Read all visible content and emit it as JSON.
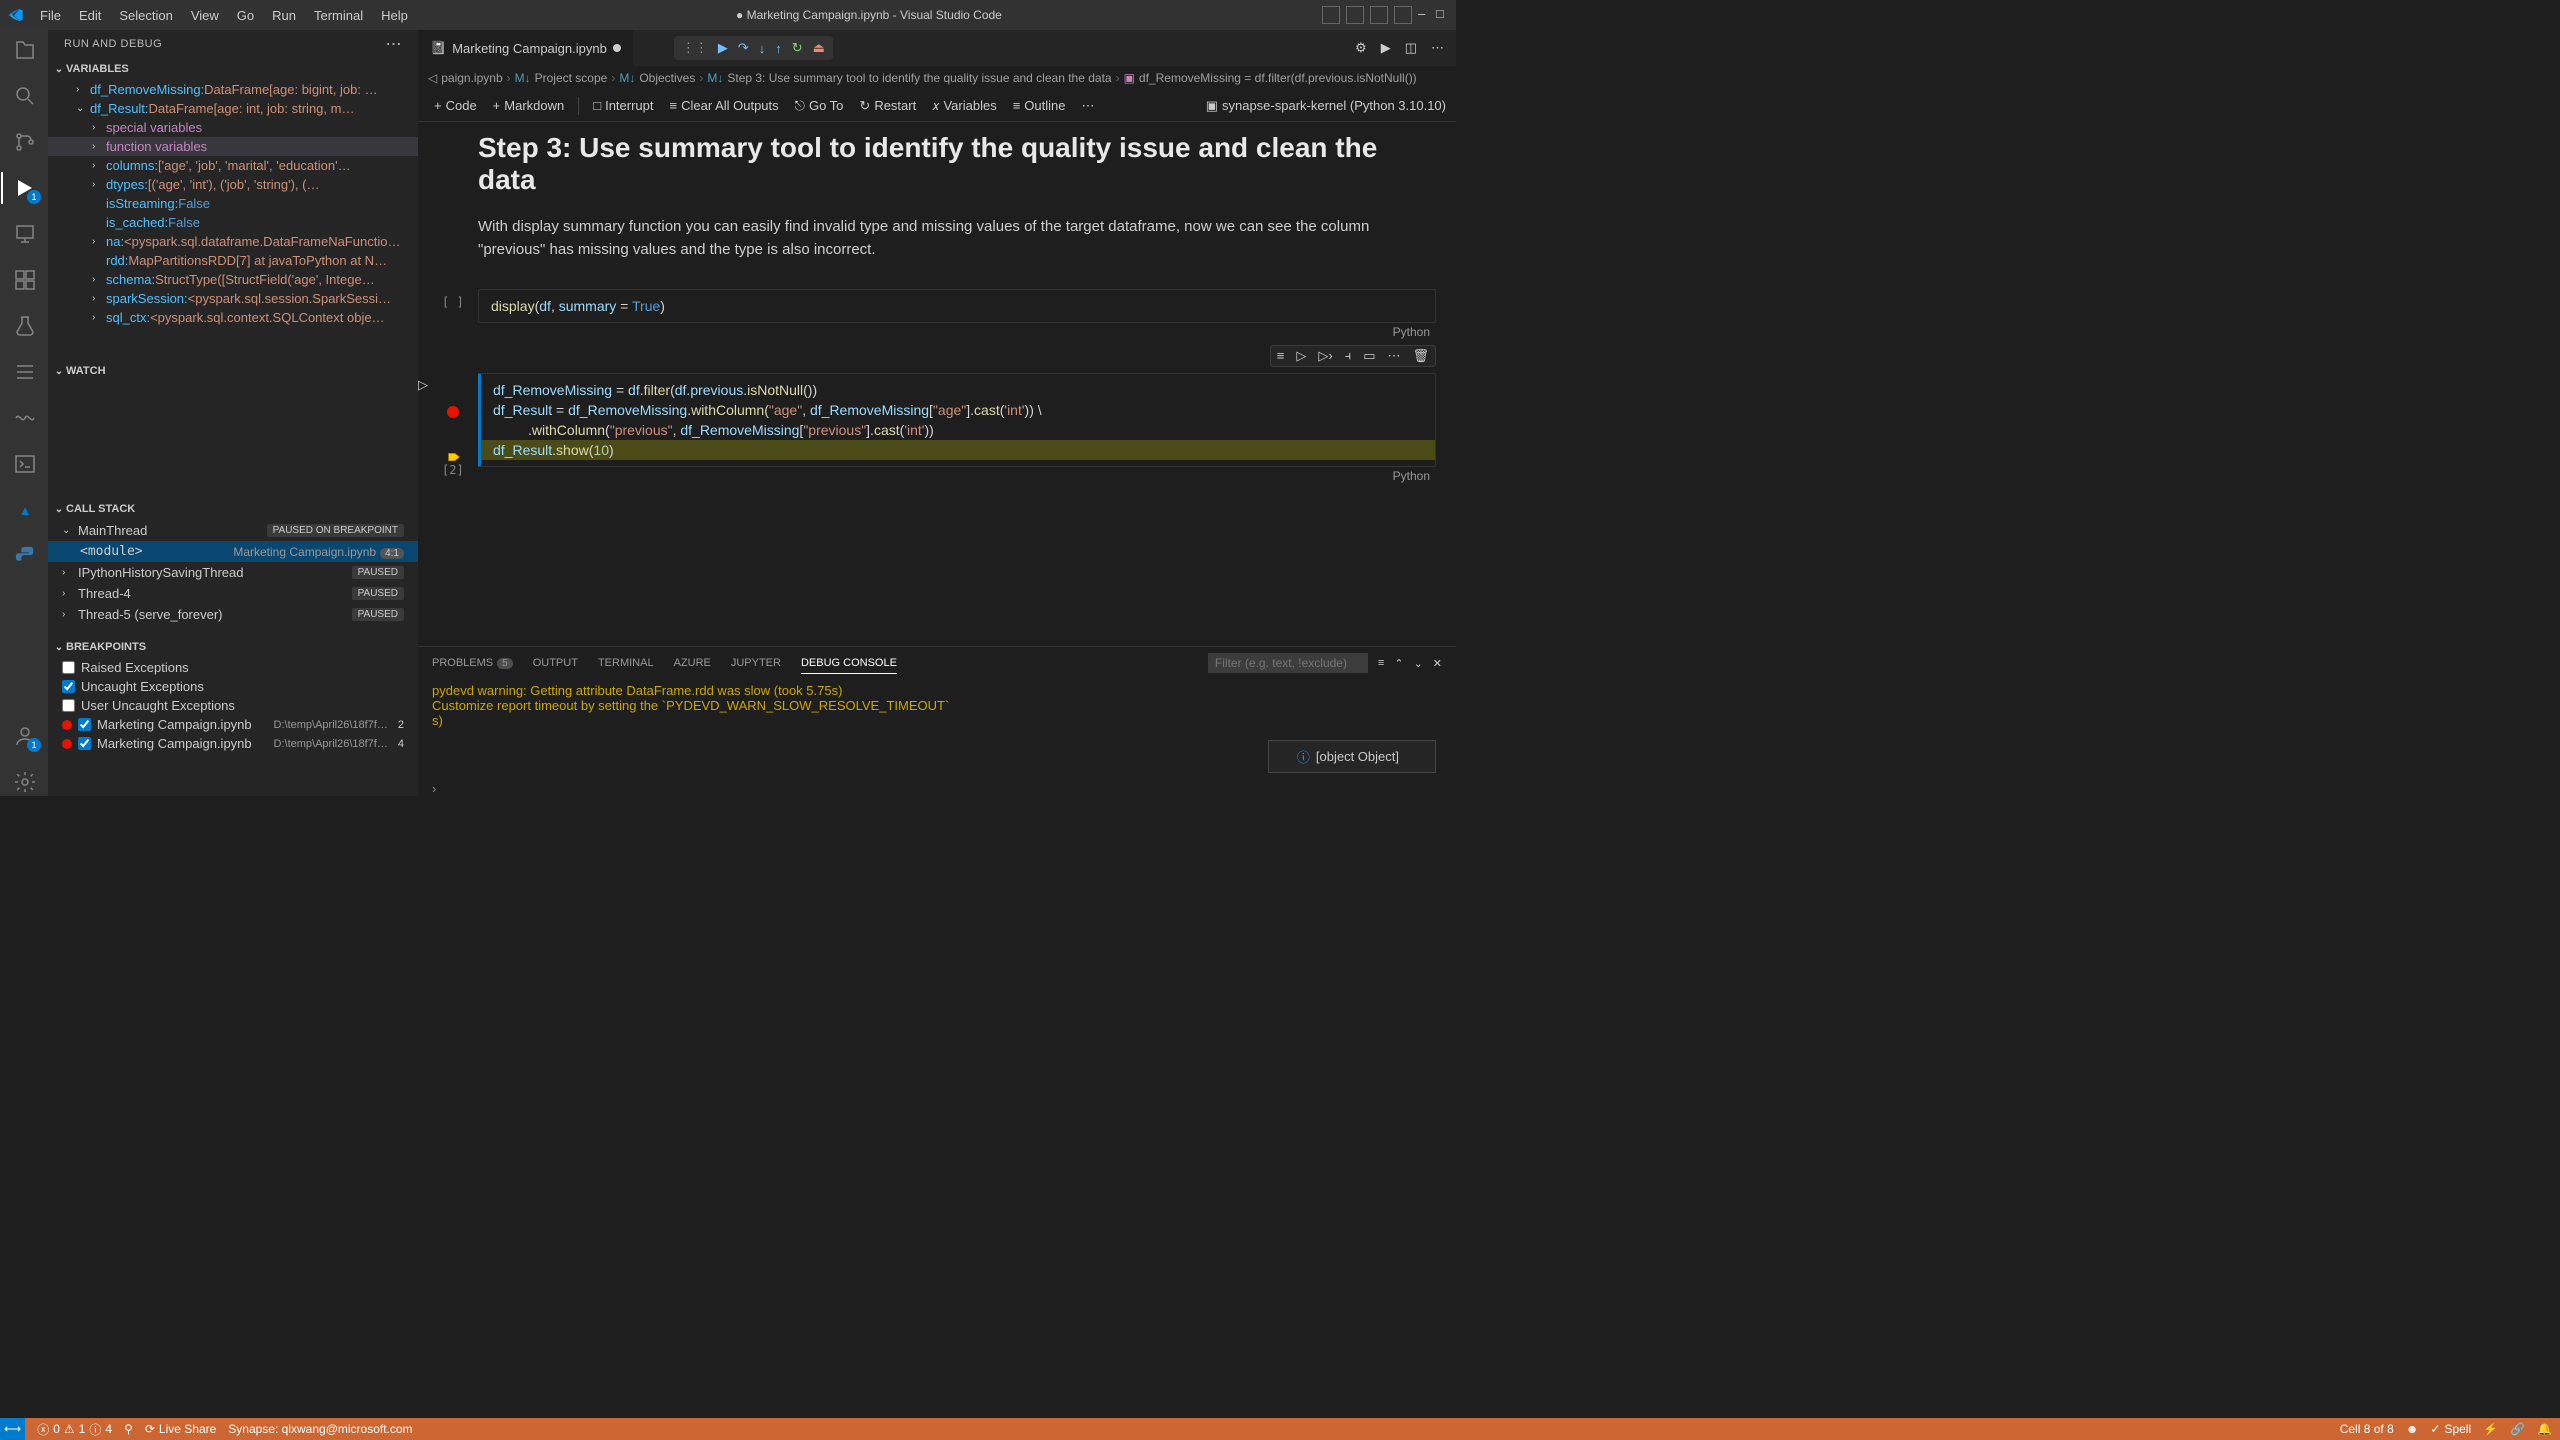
{
  "menu": {
    "file": "File",
    "edit": "Edit",
    "selection": "Selection",
    "view": "View",
    "go": "Go",
    "run": "Run",
    "terminal": "Terminal",
    "help": "Help"
  },
  "title": "● Marketing Campaign.ipynb - Visual Studio Code",
  "sidebar": {
    "title": "RUN AND DEBUG",
    "sections": {
      "variables": "VARIABLES",
      "watch": "WATCH",
      "callstack": "CALL STACK",
      "breakpoints": "BREAKPOINTS"
    },
    "vars": {
      "df_RemoveMissing": {
        "name": "df_RemoveMissing:",
        "val": " DataFrame[age: bigint, job: …"
      },
      "df_Result": {
        "name": "df_Result:",
        "val": " DataFrame[age: int, job: string, m…"
      },
      "special": "special variables",
      "function": "function variables",
      "columns": {
        "name": "columns:",
        "val": " ['age', 'job', 'marital', 'education'…"
      },
      "dtypes": {
        "name": "dtypes:",
        "val": " [('age', 'int'), ('job', 'string'), (…"
      },
      "isStreaming": {
        "name": "isStreaming:",
        "val": " False"
      },
      "is_cached": {
        "name": "is_cached:",
        "val": " False"
      },
      "na": {
        "name": "na:",
        "val": " <pyspark.sql.dataframe.DataFrameNaFunctio…"
      },
      "rdd": {
        "name": "rdd:",
        "val": " MapPartitionsRDD[7] at javaToPython at N…"
      },
      "schema": {
        "name": "schema:",
        "val": " StructType([StructField('age', Intege…"
      },
      "sparkSession": {
        "name": "sparkSession:",
        "val": " <pyspark.sql.session.SparkSessi…"
      },
      "sql_ctx": {
        "name": "sql_ctx:",
        "val": " <pyspark.sql.context.SQLContext obje…"
      }
    },
    "callstack": {
      "main": "MainThread",
      "main_badge": "PAUSED ON BREAKPOINT",
      "frame": "<module>",
      "frame_file": "Marketing Campaign.ipynb",
      "frame_line": "4:1",
      "t2": "IPythonHistorySavingThread",
      "t2_badge": "PAUSED",
      "t3": "Thread-4",
      "t3_badge": "PAUSED",
      "t4": "Thread-5 (serve_forever)",
      "t4_badge": "PAUSED"
    },
    "breakpoints": {
      "raised": "Raised Exceptions",
      "uncaught": "Uncaught Exceptions",
      "user_uncaught": "User Uncaught Exceptions",
      "bp1": "Marketing Campaign.ipynb",
      "bp1_path": "D:\\temp\\April26\\18f7f…",
      "bp1_line": "2",
      "bp2": "Marketing Campaign.ipynb",
      "bp2_path": "D:\\temp\\April26\\18f7f…",
      "bp2_line": "4"
    }
  },
  "tab": {
    "name": "Marketing Campaign.ipynb"
  },
  "breadcrumb": {
    "file": "paign.ipynb",
    "scope": "Project scope",
    "obj": "Objectives",
    "step": "Step 3: Use summary tool to identify the quality issue and clean the data",
    "code": "df_RemoveMissing = df.filter(df.previous.isNotNull())"
  },
  "nb_toolbar": {
    "code": "Code",
    "markdown": "Markdown",
    "interrupt": "Interrupt",
    "clear": "Clear All Outputs",
    "goto": "Go To",
    "restart": "Restart",
    "variables": "Variables",
    "outline": "Outline",
    "kernel": "synapse-spark-kernel (Python 3.10.10)"
  },
  "notebook": {
    "heading": "Step 3: Use summary tool to identify the quality issue and clean the data",
    "paragraph": "With display summary function you can easily find invalid type and missing values of the target dataframe, now we can see the column \"previous\" has missing values and the type is also incorrect.",
    "cell1_lang": "Python",
    "cell1_execount": "[ ]",
    "cell2_lang": "Python",
    "cell2_execount": "[2]",
    "code1": {
      "display": "display",
      "arg1": "df",
      "arg2name": "summary",
      "arg2val": "True"
    },
    "code2": {
      "l1a": "df_RemoveMissing",
      "l1b": "df",
      "l1c": "filter",
      "l1d": "df",
      "l1e": "previous",
      "l1f": "isNotNull",
      "l2a": "df_Result",
      "l2b": "df_RemoveMissing",
      "l2c": "withColumn",
      "l2s1": "\"age\"",
      "l2d": "df_RemoveMissing",
      "l2s2": "\"age\"",
      "l2e": "cast",
      "l2s3": "'int'",
      "l3a": "withColumn",
      "l3s1": "\"previous\"",
      "l3b": "df_RemoveMissing",
      "l3s2": "\"previous\"",
      "l3c": "cast",
      "l3s3": "'int'",
      "l4a": "df_Result",
      "l4b": "show",
      "l4n": "10"
    }
  },
  "panel": {
    "tabs": {
      "problems": "PROBLEMS",
      "problems_count": "5",
      "output": "OUTPUT",
      "terminal": "TERMINAL",
      "azure": "AZURE",
      "jupyter": "JUPYTER",
      "debug": "DEBUG CONSOLE"
    },
    "filter_placeholder": "Filter (e.g. text, !exclude)",
    "lines": {
      "l1a": "pydevd warning: Getting attribute ",
      "l1b": "DataFrame.rdd",
      "l1c": " was slow (took ",
      "l1d": "5.75s",
      "l1e": ")",
      "l2a": "Customize report timeout by setting the `",
      "l2b": "PYDEVD_WARN_SLOW_RESOLVE_TIMEOUT",
      "l2c": "`",
      "l3": "s)"
    },
    "notif": "[object Object]"
  },
  "status": {
    "errors": "0",
    "warnings": "1",
    "info": "4",
    "liveshare": "Live Share",
    "synapse": "Synapse: qixwang@microsoft.com",
    "cell": "Cell 8 of 8",
    "spell": "Spell"
  }
}
